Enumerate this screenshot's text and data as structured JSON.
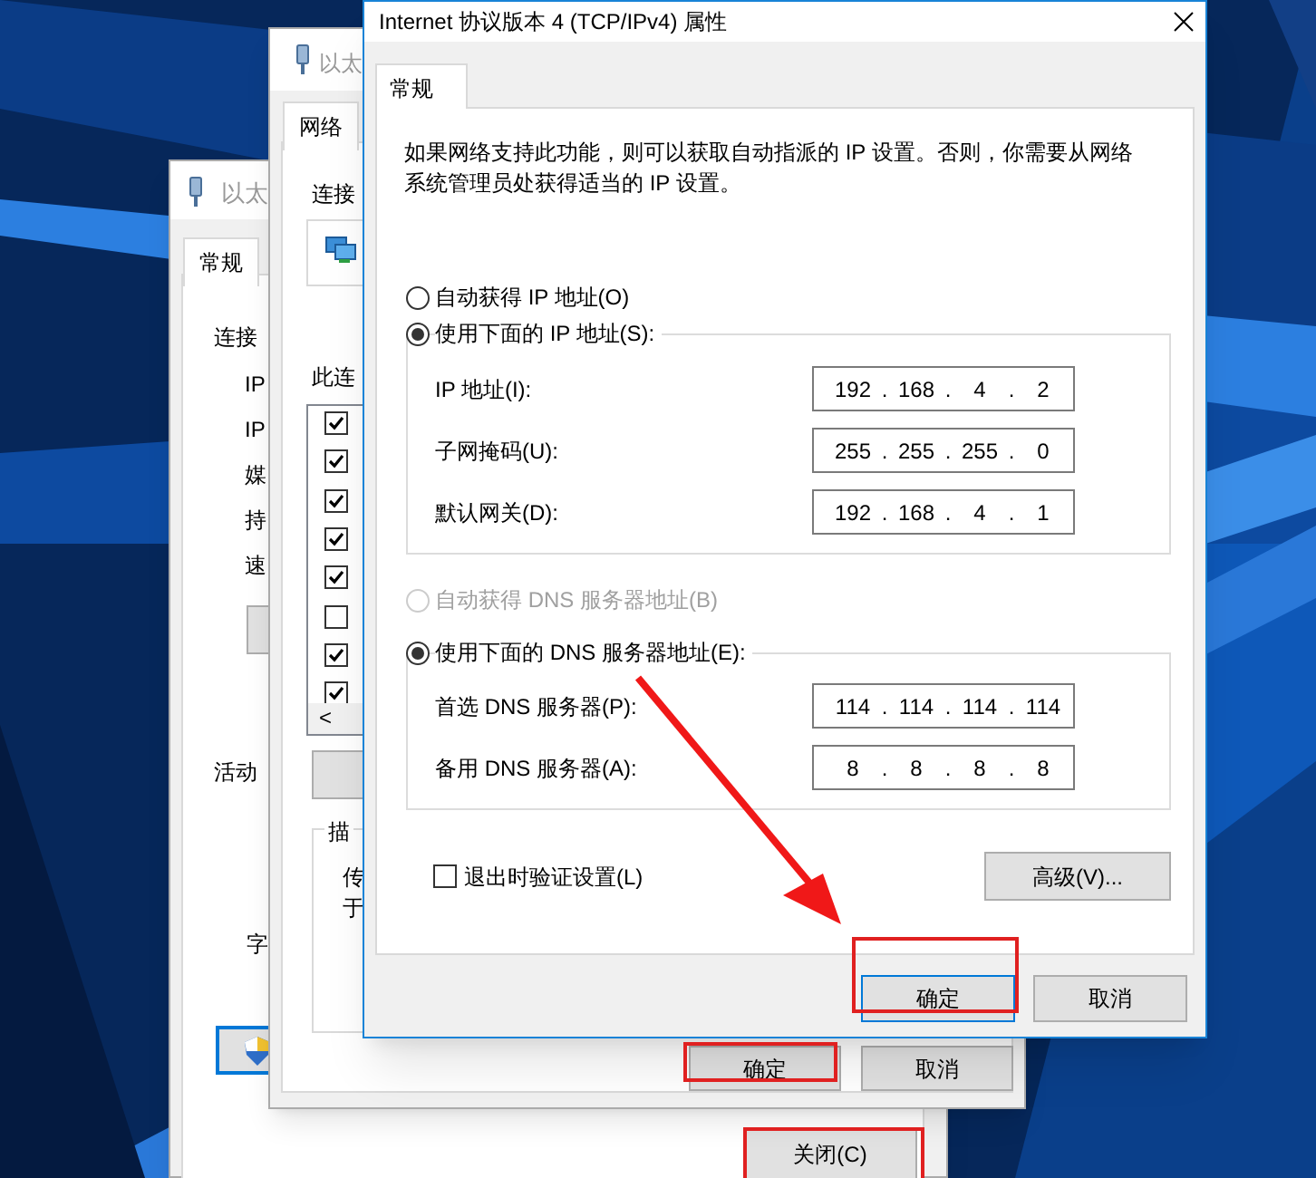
{
  "back_window": {
    "title": "以太",
    "tab": {
      "label": "常规",
      "selected": true
    },
    "section_labels": [
      "连接",
      "活动"
    ],
    "rows": [
      "IP",
      "IP",
      "媒",
      "持",
      "速"
    ],
    "bottom_label": "字",
    "close_button": "关闭(C)"
  },
  "middle_window": {
    "title": "以太",
    "tab": {
      "label": "网络",
      "selected": true
    },
    "connect_label": "连接",
    "list_label": "此连",
    "items": [
      {
        "checked": true
      },
      {
        "checked": true
      },
      {
        "checked": true
      },
      {
        "checked": true
      },
      {
        "checked": true
      },
      {
        "checked": false
      },
      {
        "checked": true
      },
      {
        "checked": true
      }
    ],
    "scroll_left": "<",
    "description": {
      "legend": "描",
      "lines": [
        "传",
        "于"
      ]
    },
    "buttons": [
      "确定",
      "取消"
    ]
  },
  "dialog": {
    "title": "Internet 协议版本 4 (TCP/IPv4) 属性",
    "tab": {
      "label": "常规",
      "selected": true
    },
    "intro": "如果网络支持此功能，则可以获取自动指派的 IP 设置。否则，你需要从网络系统管理员处获得适当的 IP 设置。",
    "ip_auto": {
      "label": "自动获得 IP 地址(O)",
      "selected": false,
      "disabled": false
    },
    "ip_manual": {
      "label": "使用下面的 IP 地址(S):",
      "selected": true,
      "disabled": false
    },
    "ip_fields": [
      {
        "label": "IP 地址(I):",
        "value": "192 . 168 . 4 . 2"
      },
      {
        "label": "子网掩码(U):",
        "value": "255 . 255 . 255 . 0"
      },
      {
        "label": "默认网关(D):",
        "value": "192 . 168 . 4 . 1"
      }
    ],
    "dns_auto": {
      "label": "自动获得 DNS 服务器地址(B)",
      "selected": false,
      "disabled": true
    },
    "dns_manual": {
      "label": "使用下面的 DNS 服务器地址(E):",
      "selected": true,
      "disabled": false
    },
    "dns_fields": [
      {
        "label": "首选 DNS 服务器(P):",
        "value": "114 . 114 . 114 . 114"
      },
      {
        "label": "备用 DNS 服务器(A):",
        "value": "8 . 8 . 8 . 8"
      }
    ],
    "validate": {
      "label": "退出时验证设置(L)",
      "checked": false
    },
    "advanced_button": "高级(V)...",
    "buttons": [
      "确定",
      "取消"
    ]
  }
}
